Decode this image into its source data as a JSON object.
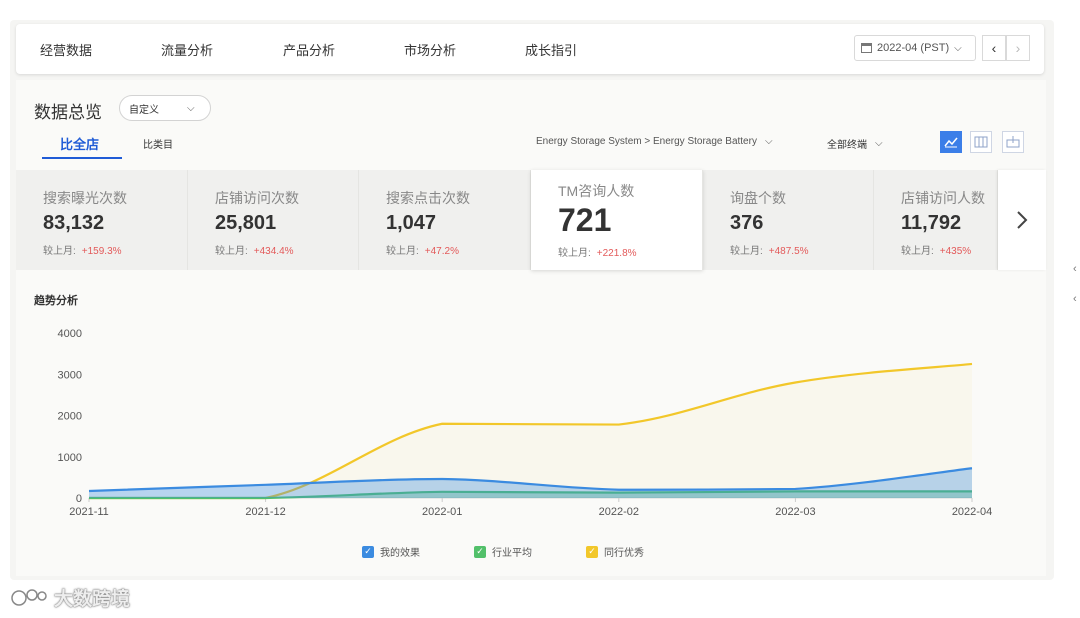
{
  "nav": {
    "items": [
      "经营数据",
      "流量分析",
      "产品分析",
      "市场分析",
      "成长指引"
    ],
    "date": "2022-04 (PST)"
  },
  "overview": {
    "title": "数据总览",
    "custom_select": "自定义",
    "tabs": [
      "比全店",
      "比类目"
    ],
    "breadcrumb": "Energy Storage System > Energy Storage Battery",
    "terminal": "全部终端"
  },
  "cards": [
    {
      "label": "搜索曝光次数",
      "value": "83,132",
      "compare_label": "较上月:",
      "change": "+159.3%"
    },
    {
      "label": "店铺访问次数",
      "value": "25,801",
      "compare_label": "较上月:",
      "change": "+434.4%"
    },
    {
      "label": "搜索点击次数",
      "value": "1,047",
      "compare_label": "较上月:",
      "change": "+47.2%"
    },
    {
      "label": "TM咨询人数",
      "value": "721",
      "compare_label": "较上月:",
      "change": "+221.8%"
    },
    {
      "label": "询盘个数",
      "value": "376",
      "compare_label": "较上月:",
      "change": "+487.5%"
    },
    {
      "label": "店铺访问人数",
      "value": "11,792",
      "compare_label": "较上月:",
      "change": "+435%"
    }
  ],
  "trend": {
    "title": "趋势分析"
  },
  "chart_data": {
    "type": "line",
    "x": [
      "2021-11",
      "2021-12",
      "2022-01",
      "2022-02",
      "2022-03",
      "2022-04"
    ],
    "y_ticks": [
      "0",
      "1000",
      "2000",
      "3000",
      "4000"
    ],
    "ylim": [
      0,
      4000
    ],
    "legend_position": "bottom",
    "series": [
      {
        "name": "我的效果",
        "color": "#3b8be0",
        "values": [
          170,
          320,
          460,
          200,
          220,
          721
        ]
      },
      {
        "name": "行业平均",
        "color": "#52c06a",
        "values": [
          0,
          0,
          150,
          130,
          160,
          160
        ]
      },
      {
        "name": "同行优秀",
        "color": "#f2c72a",
        "values": [
          0,
          0,
          1800,
          1780,
          2800,
          3250
        ]
      }
    ]
  },
  "watermark": "大数跨境",
  "colors": {
    "accent": "#1f5bd6",
    "increase": "#e35a5a"
  }
}
